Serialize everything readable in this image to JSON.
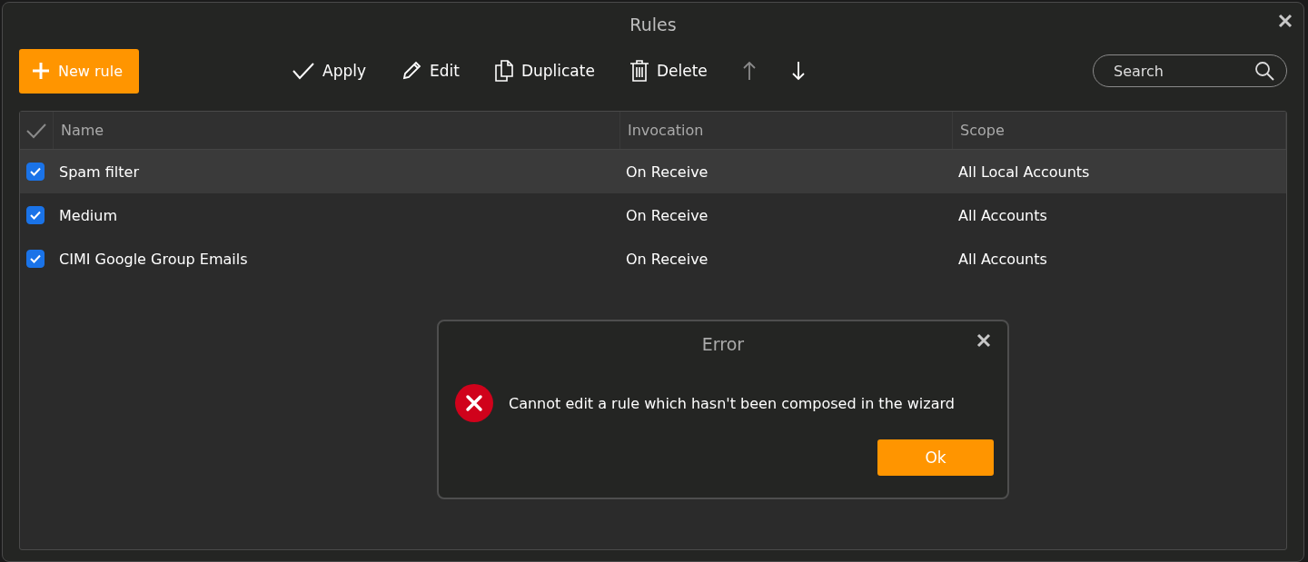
{
  "window": {
    "title": "Rules"
  },
  "new_rule_button": {
    "label": "New rule"
  },
  "toolbar": [
    {
      "kind": "apply",
      "label": "Apply",
      "disabled": false
    },
    {
      "kind": "edit",
      "label": "Edit",
      "disabled": false
    },
    {
      "kind": "duplicate",
      "label": "Duplicate",
      "disabled": false
    },
    {
      "kind": "delete",
      "label": "Delete",
      "disabled": false
    },
    {
      "kind": "up",
      "disabled": true
    },
    {
      "kind": "down",
      "disabled": false
    }
  ],
  "search": {
    "placeholder": "Search"
  },
  "table": {
    "columns": [
      "Name",
      "Invocation",
      "Scope"
    ],
    "rows": [
      {
        "checked": true,
        "selected": true,
        "cells": [
          "Spam filter",
          "On Receive",
          "All Local Accounts"
        ]
      },
      {
        "checked": true,
        "selected": false,
        "cells": [
          "Medium",
          "On Receive",
          "All Accounts"
        ]
      },
      {
        "checked": true,
        "selected": false,
        "cells": [
          "CIMI Google Group Emails",
          "On Receive",
          "All Accounts"
        ]
      }
    ]
  },
  "dialog": {
    "title": "Error",
    "message": "Cannot edit a rule which hasn't been composed in the wizard",
    "button": "Ok"
  }
}
